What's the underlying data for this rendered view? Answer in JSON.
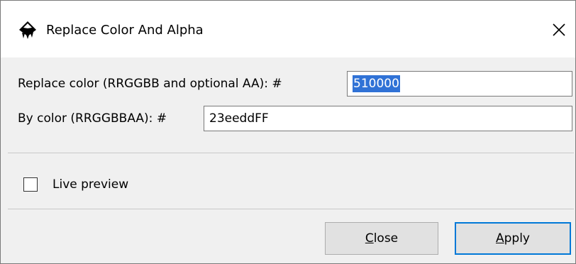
{
  "window": {
    "title": "Replace Color And Alpha"
  },
  "icons": {
    "app": "inkscape-icon",
    "close": "close-icon"
  },
  "form": {
    "replace_label": "Replace color (RRGGBB and optional AA): #",
    "replace_value": "510000",
    "by_label": "By color (RRGGBBAA): #",
    "by_value": "23eeddFF"
  },
  "preview": {
    "label": "Live preview",
    "checked": false
  },
  "buttons": {
    "close_mnemonic": "C",
    "close_rest": "lose",
    "apply_mnemonic": "A",
    "apply_rest": "pply"
  },
  "colors": {
    "selection": "#3072d6",
    "focus_border": "#0078d7"
  }
}
